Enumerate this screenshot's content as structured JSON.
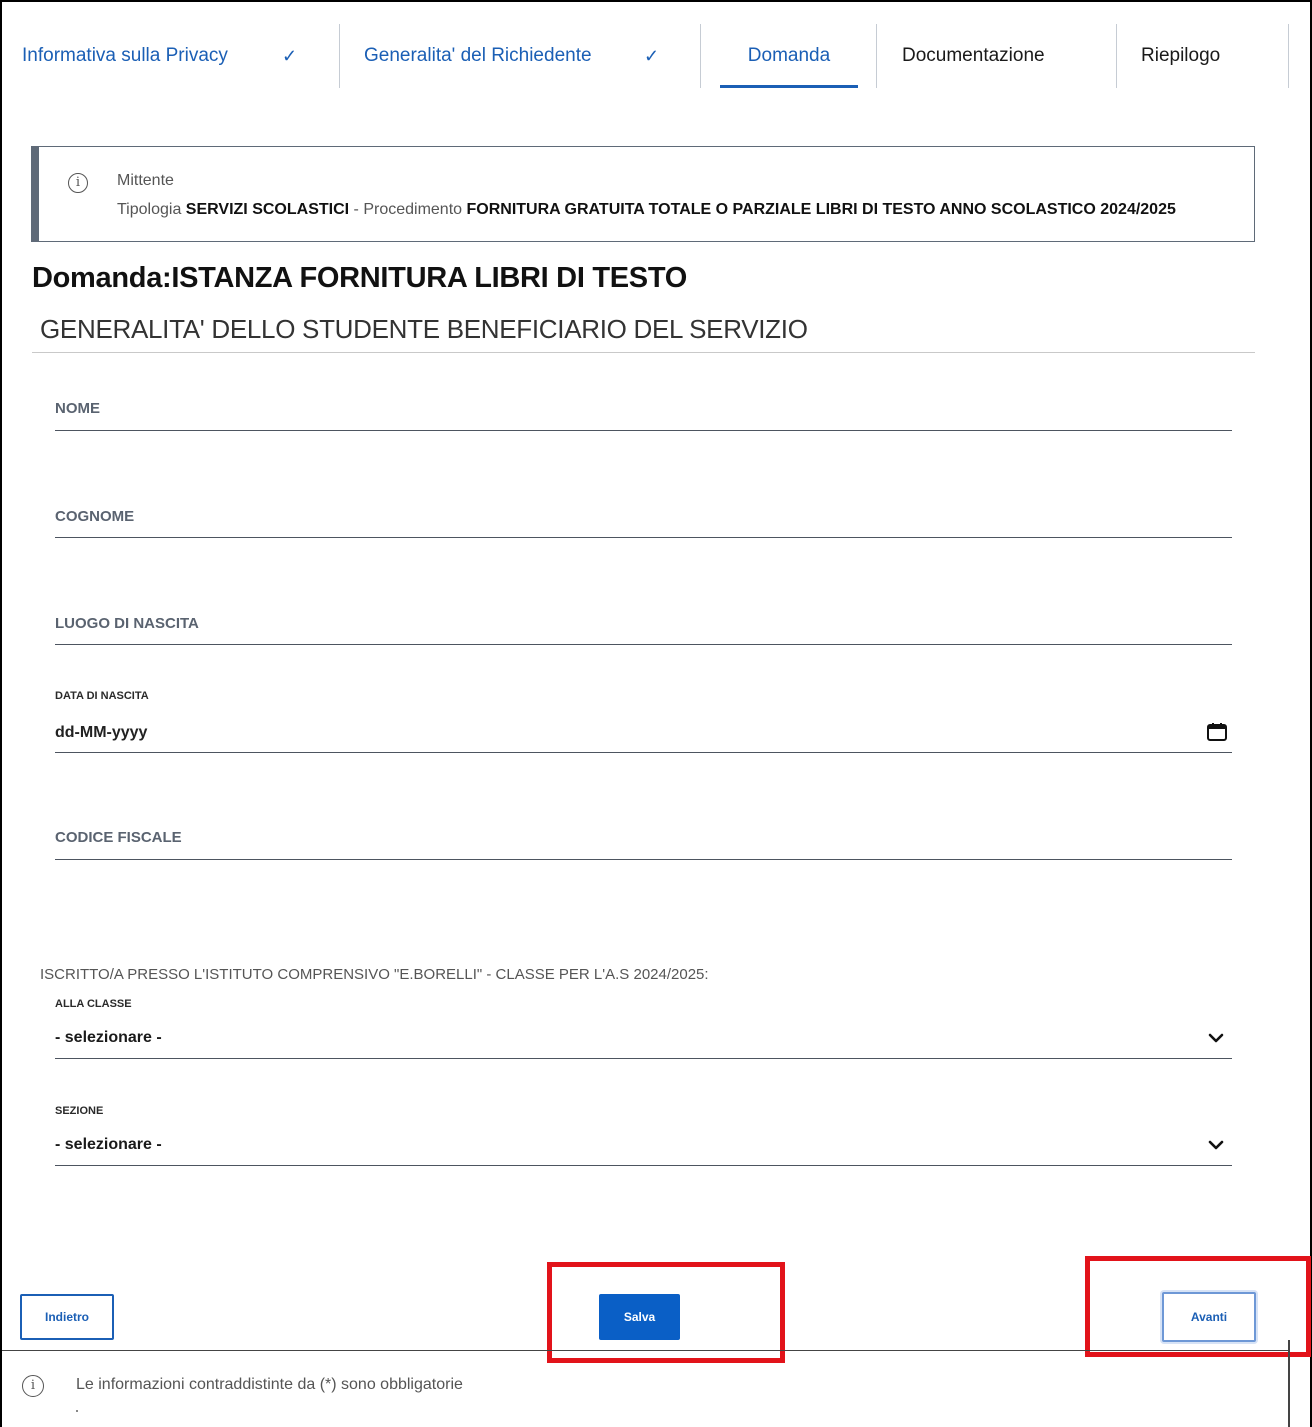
{
  "stepper": {
    "steps": [
      {
        "label": "Informativa sulla Privacy",
        "status": "done",
        "check": "✓"
      },
      {
        "label": "Generalita' del Richiedente",
        "status": "done",
        "check": "✓"
      },
      {
        "label": "Domanda",
        "status": "active"
      },
      {
        "label": "Documentazione",
        "status": "pending"
      },
      {
        "label": "Riepilogo",
        "status": "pending"
      }
    ]
  },
  "info": {
    "icon": "info-icon",
    "sender": "Mittente",
    "type_prefix": "Tipologia",
    "type_value": "SERVIZI SCOLASTICI",
    "separator": "-",
    "procedure_prefix": "Procedimento",
    "procedure_value": "FORNITURA GRATUITA TOTALE O PARZIALE LIBRI DI TESTO ANNO SCOLASTICO 2024/2025"
  },
  "page_title": "Domanda:ISTANZA FORNITURA LIBRI DI TESTO",
  "section_title": "GENERALITA' DELLO STUDENTE BENEFICIARIO DEL SERVIZIO",
  "fields": {
    "nome": {
      "label": "NOME",
      "value": ""
    },
    "cognome": {
      "label": "COGNOME",
      "value": ""
    },
    "luogo_nascita": {
      "label": "LUOGO DI NASCITA",
      "value": ""
    },
    "data_nascita": {
      "label": "DATA DI NASCITA",
      "placeholder": "dd-MM-yyyy",
      "icon": "calendar-icon"
    },
    "codice_fiscale": {
      "label": "CODICE FISCALE",
      "value": ""
    }
  },
  "enrollment": {
    "caption": "ISCRITTO/A PRESSO L'ISTITUTO COMPRENSIVO \"E.BORELLI\" - CLASSE PER L'A.S 2024/2025:",
    "classe": {
      "label": "ALLA CLASSE",
      "selected": "- selezionare -",
      "icon": "chevron-down-icon"
    },
    "sezione": {
      "label": "SEZIONE",
      "selected": "- selezionare -",
      "icon": "chevron-down-icon"
    }
  },
  "buttons": {
    "back": "Indietro",
    "save": "Salva",
    "next": "Avanti"
  },
  "footer": {
    "icon": "info-icon",
    "note": "Le informazioni contraddistinte da (*) sono obbligatorie"
  },
  "colors": {
    "accent": "#1b5fb5",
    "primary_button": "#0a5fc6",
    "highlight": "#e2131a"
  }
}
